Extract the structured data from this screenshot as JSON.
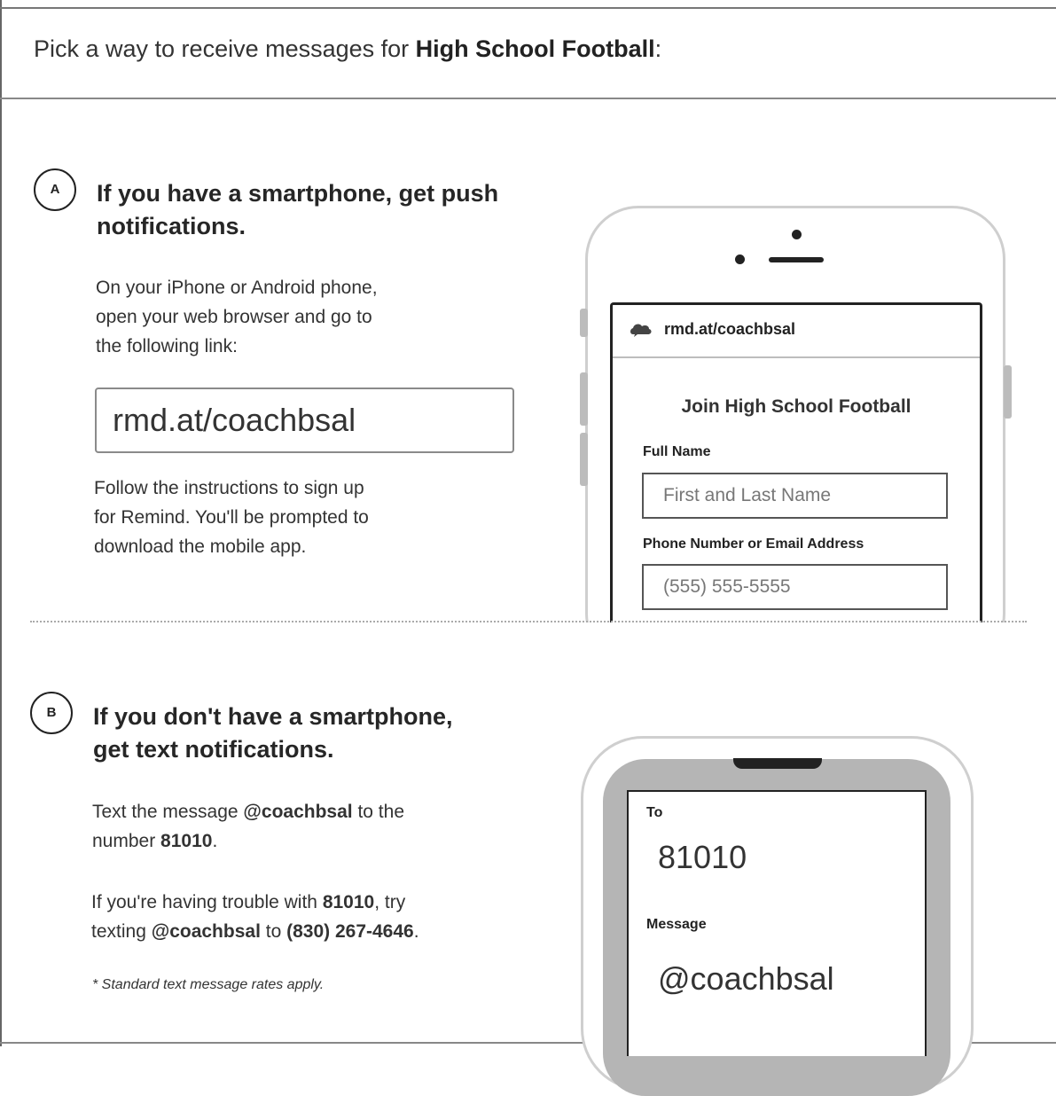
{
  "header": {
    "prefix": "Pick a way to receive messages for ",
    "class_name": "High School Football",
    "suffix": ":"
  },
  "option_a": {
    "badge": "A",
    "title_line1": "If you have a smartphone, get push",
    "title_line2": "notifications.",
    "instructions": [
      "On your iPhone or Android phone,",
      "open your web browser and go to",
      "the following link:"
    ],
    "link": "rmd.at/coachbsal",
    "follow_up": [
      "Follow the instructions to sign up",
      "for Remind. You'll be prompted to",
      "download the mobile app."
    ],
    "phone": {
      "url": "rmd.at/coachbsal",
      "join_title": "Join High School Football",
      "full_name_label": "Full Name",
      "full_name_placeholder": "First and Last Name",
      "contact_label": "Phone Number or Email Address",
      "contact_placeholder": "(555) 555-5555"
    }
  },
  "option_b": {
    "badge": "B",
    "title_line1": "If you don't have a smartphone,",
    "title_line2": "get text notifications.",
    "text_prefix": "Text the message ",
    "text_code": "@coachbsal",
    "text_middle": " to the",
    "text_line2_prefix": "number ",
    "text_number": "81010",
    "text_line2_suffix": ".",
    "trouble_prefix": "If you're having trouble with ",
    "trouble_number": "81010",
    "trouble_suffix": ", try",
    "trouble_line2_prefix": "texting ",
    "trouble_code": "@coachbsal",
    "trouble_line2_middle": " to ",
    "trouble_phone": "(830) 267-4646",
    "trouble_line2_suffix": ".",
    "footnote": "* Standard text message rates apply.",
    "phone": {
      "to_label": "To",
      "to_value": "81010",
      "message_label": "Message",
      "message_value": "@coachbsal"
    }
  }
}
